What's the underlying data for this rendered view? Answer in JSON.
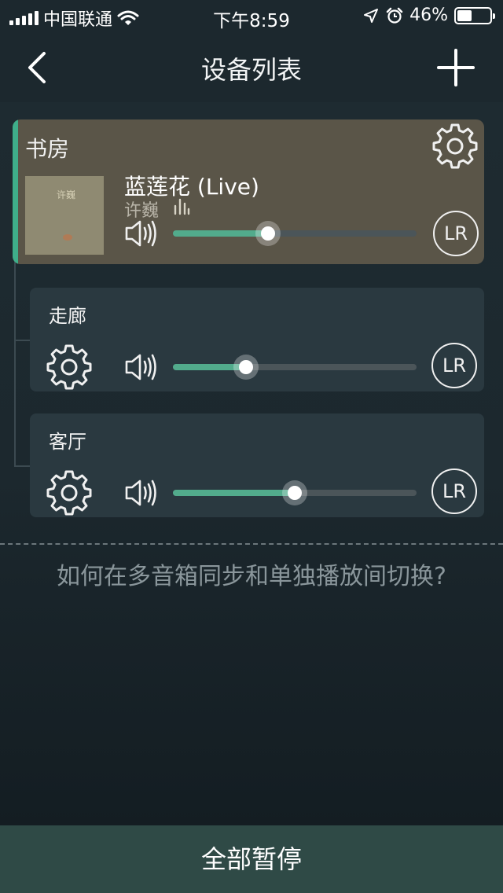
{
  "status_bar": {
    "carrier": "中国联通",
    "time": "下午8:59",
    "battery": "46%",
    "battery_level": 0.46
  },
  "nav": {
    "title": "设备列表",
    "back_icon": "chevron-left-icon",
    "add_icon": "plus-icon"
  },
  "active_device": {
    "room": "书房",
    "song_title": "蓝莲花 (Live)",
    "artist": "许巍",
    "album_text": "许巍",
    "volume": 0.39,
    "channel_label": "LR"
  },
  "devices": [
    {
      "room": "走廊",
      "volume": 0.3,
      "channel_label": "LR"
    },
    {
      "room": "客厅",
      "volume": 0.5,
      "channel_label": "LR"
    }
  ],
  "help_link": "如何在多音箱同步和单独播放间切换?",
  "bottom_button": "全部暂停",
  "colors": {
    "accent": "#3fae8a",
    "slider_fill": "#52ab8c",
    "active_card": "#5a5548",
    "card": "#2a3940"
  }
}
